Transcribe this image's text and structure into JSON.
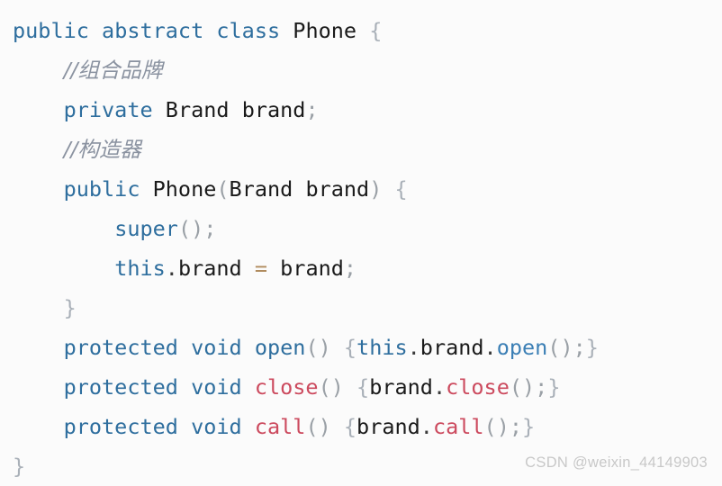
{
  "editor": {
    "language": "java",
    "background_color": "#fbfbfb",
    "class_name": "Phone"
  },
  "palette": {
    "keyword": "#2e6e9e",
    "plain": "#1a1a1a",
    "comment": "#8a92a0",
    "brace": "#a9b0b8",
    "punct": "#9aa0a6",
    "method": "#2e6e9e",
    "call": "#3b7fb5",
    "special_method": "#cc4a5e",
    "operator": "#b08b5e",
    "watermark": "#c8c8c8"
  },
  "code": {
    "lines": [
      {
        "indent": 0,
        "tokens": [
          {
            "t": "public",
            "c": "keyword"
          },
          {
            "t": " ",
            "c": "plain"
          },
          {
            "t": "abstract",
            "c": "keyword"
          },
          {
            "t": " ",
            "c": "plain"
          },
          {
            "t": "class",
            "c": "keyword"
          },
          {
            "t": " ",
            "c": "plain"
          },
          {
            "t": "Phone",
            "c": "plain"
          },
          {
            "t": " ",
            "c": "plain"
          },
          {
            "t": "{",
            "c": "brace"
          }
        ]
      },
      {
        "indent": 1,
        "tokens": [
          {
            "t": "//组合品牌",
            "c": "comment"
          }
        ]
      },
      {
        "indent": 1,
        "tokens": [
          {
            "t": "private",
            "c": "keyword"
          },
          {
            "t": " ",
            "c": "plain"
          },
          {
            "t": "Brand",
            "c": "plain"
          },
          {
            "t": " ",
            "c": "plain"
          },
          {
            "t": "brand",
            "c": "plain"
          },
          {
            "t": ";",
            "c": "punct"
          }
        ]
      },
      {
        "indent": 1,
        "tokens": [
          {
            "t": "//构造器",
            "c": "comment"
          }
        ]
      },
      {
        "indent": 1,
        "tokens": [
          {
            "t": "public",
            "c": "keyword"
          },
          {
            "t": " ",
            "c": "plain"
          },
          {
            "t": "Phone",
            "c": "plain"
          },
          {
            "t": "(",
            "c": "punct"
          },
          {
            "t": "Brand",
            "c": "plain"
          },
          {
            "t": " ",
            "c": "plain"
          },
          {
            "t": "brand",
            "c": "plain"
          },
          {
            "t": ")",
            "c": "punct"
          },
          {
            "t": " ",
            "c": "plain"
          },
          {
            "t": "{",
            "c": "brace"
          }
        ]
      },
      {
        "indent": 2,
        "tokens": [
          {
            "t": "super",
            "c": "keyword"
          },
          {
            "t": "()",
            "c": "punct"
          },
          {
            "t": ";",
            "c": "punct"
          }
        ]
      },
      {
        "indent": 2,
        "tokens": [
          {
            "t": "this",
            "c": "keyword"
          },
          {
            "t": ".",
            "c": "dot"
          },
          {
            "t": "brand",
            "c": "plain"
          },
          {
            "t": " ",
            "c": "plain"
          },
          {
            "t": "=",
            "c": "operator"
          },
          {
            "t": " ",
            "c": "plain"
          },
          {
            "t": "brand",
            "c": "plain"
          },
          {
            "t": ";",
            "c": "punct"
          }
        ]
      },
      {
        "indent": 1,
        "tokens": [
          {
            "t": "}",
            "c": "brace"
          }
        ]
      },
      {
        "indent": 1,
        "tokens": [
          {
            "t": "protected",
            "c": "keyword"
          },
          {
            "t": " ",
            "c": "plain"
          },
          {
            "t": "void",
            "c": "keyword"
          },
          {
            "t": " ",
            "c": "plain"
          },
          {
            "t": "open",
            "c": "method"
          },
          {
            "t": "()",
            "c": "punct"
          },
          {
            "t": " ",
            "c": "plain"
          },
          {
            "t": "{",
            "c": "brace"
          },
          {
            "t": "this",
            "c": "keyword"
          },
          {
            "t": ".",
            "c": "dot"
          },
          {
            "t": "brand",
            "c": "plain"
          },
          {
            "t": ".",
            "c": "dot"
          },
          {
            "t": "open",
            "c": "call"
          },
          {
            "t": "()",
            "c": "punct"
          },
          {
            "t": ";",
            "c": "punct"
          },
          {
            "t": "}",
            "c": "brace"
          }
        ]
      },
      {
        "indent": 1,
        "tokens": [
          {
            "t": "protected",
            "c": "keyword"
          },
          {
            "t": " ",
            "c": "plain"
          },
          {
            "t": "void",
            "c": "keyword"
          },
          {
            "t": " ",
            "c": "plain"
          },
          {
            "t": "close",
            "c": "special"
          },
          {
            "t": "()",
            "c": "punct"
          },
          {
            "t": " ",
            "c": "plain"
          },
          {
            "t": "{",
            "c": "brace"
          },
          {
            "t": "brand",
            "c": "plain"
          },
          {
            "t": ".",
            "c": "dot"
          },
          {
            "t": "close",
            "c": "special"
          },
          {
            "t": "()",
            "c": "punct"
          },
          {
            "t": ";",
            "c": "punct"
          },
          {
            "t": "}",
            "c": "brace"
          }
        ]
      },
      {
        "indent": 1,
        "tokens": [
          {
            "t": "protected",
            "c": "keyword"
          },
          {
            "t": " ",
            "c": "plain"
          },
          {
            "t": "void",
            "c": "keyword"
          },
          {
            "t": " ",
            "c": "plain"
          },
          {
            "t": "call",
            "c": "special"
          },
          {
            "t": "()",
            "c": "punct"
          },
          {
            "t": " ",
            "c": "plain"
          },
          {
            "t": "{",
            "c": "brace"
          },
          {
            "t": "brand",
            "c": "plain"
          },
          {
            "t": ".",
            "c": "dot"
          },
          {
            "t": "call",
            "c": "special"
          },
          {
            "t": "()",
            "c": "punct"
          },
          {
            "t": ";",
            "c": "punct"
          },
          {
            "t": "}",
            "c": "brace"
          }
        ]
      },
      {
        "indent": 0,
        "tokens": [
          {
            "t": "}",
            "c": "brace"
          }
        ]
      }
    ]
  },
  "watermark": {
    "text": "CSDN @weixin_44149903"
  }
}
